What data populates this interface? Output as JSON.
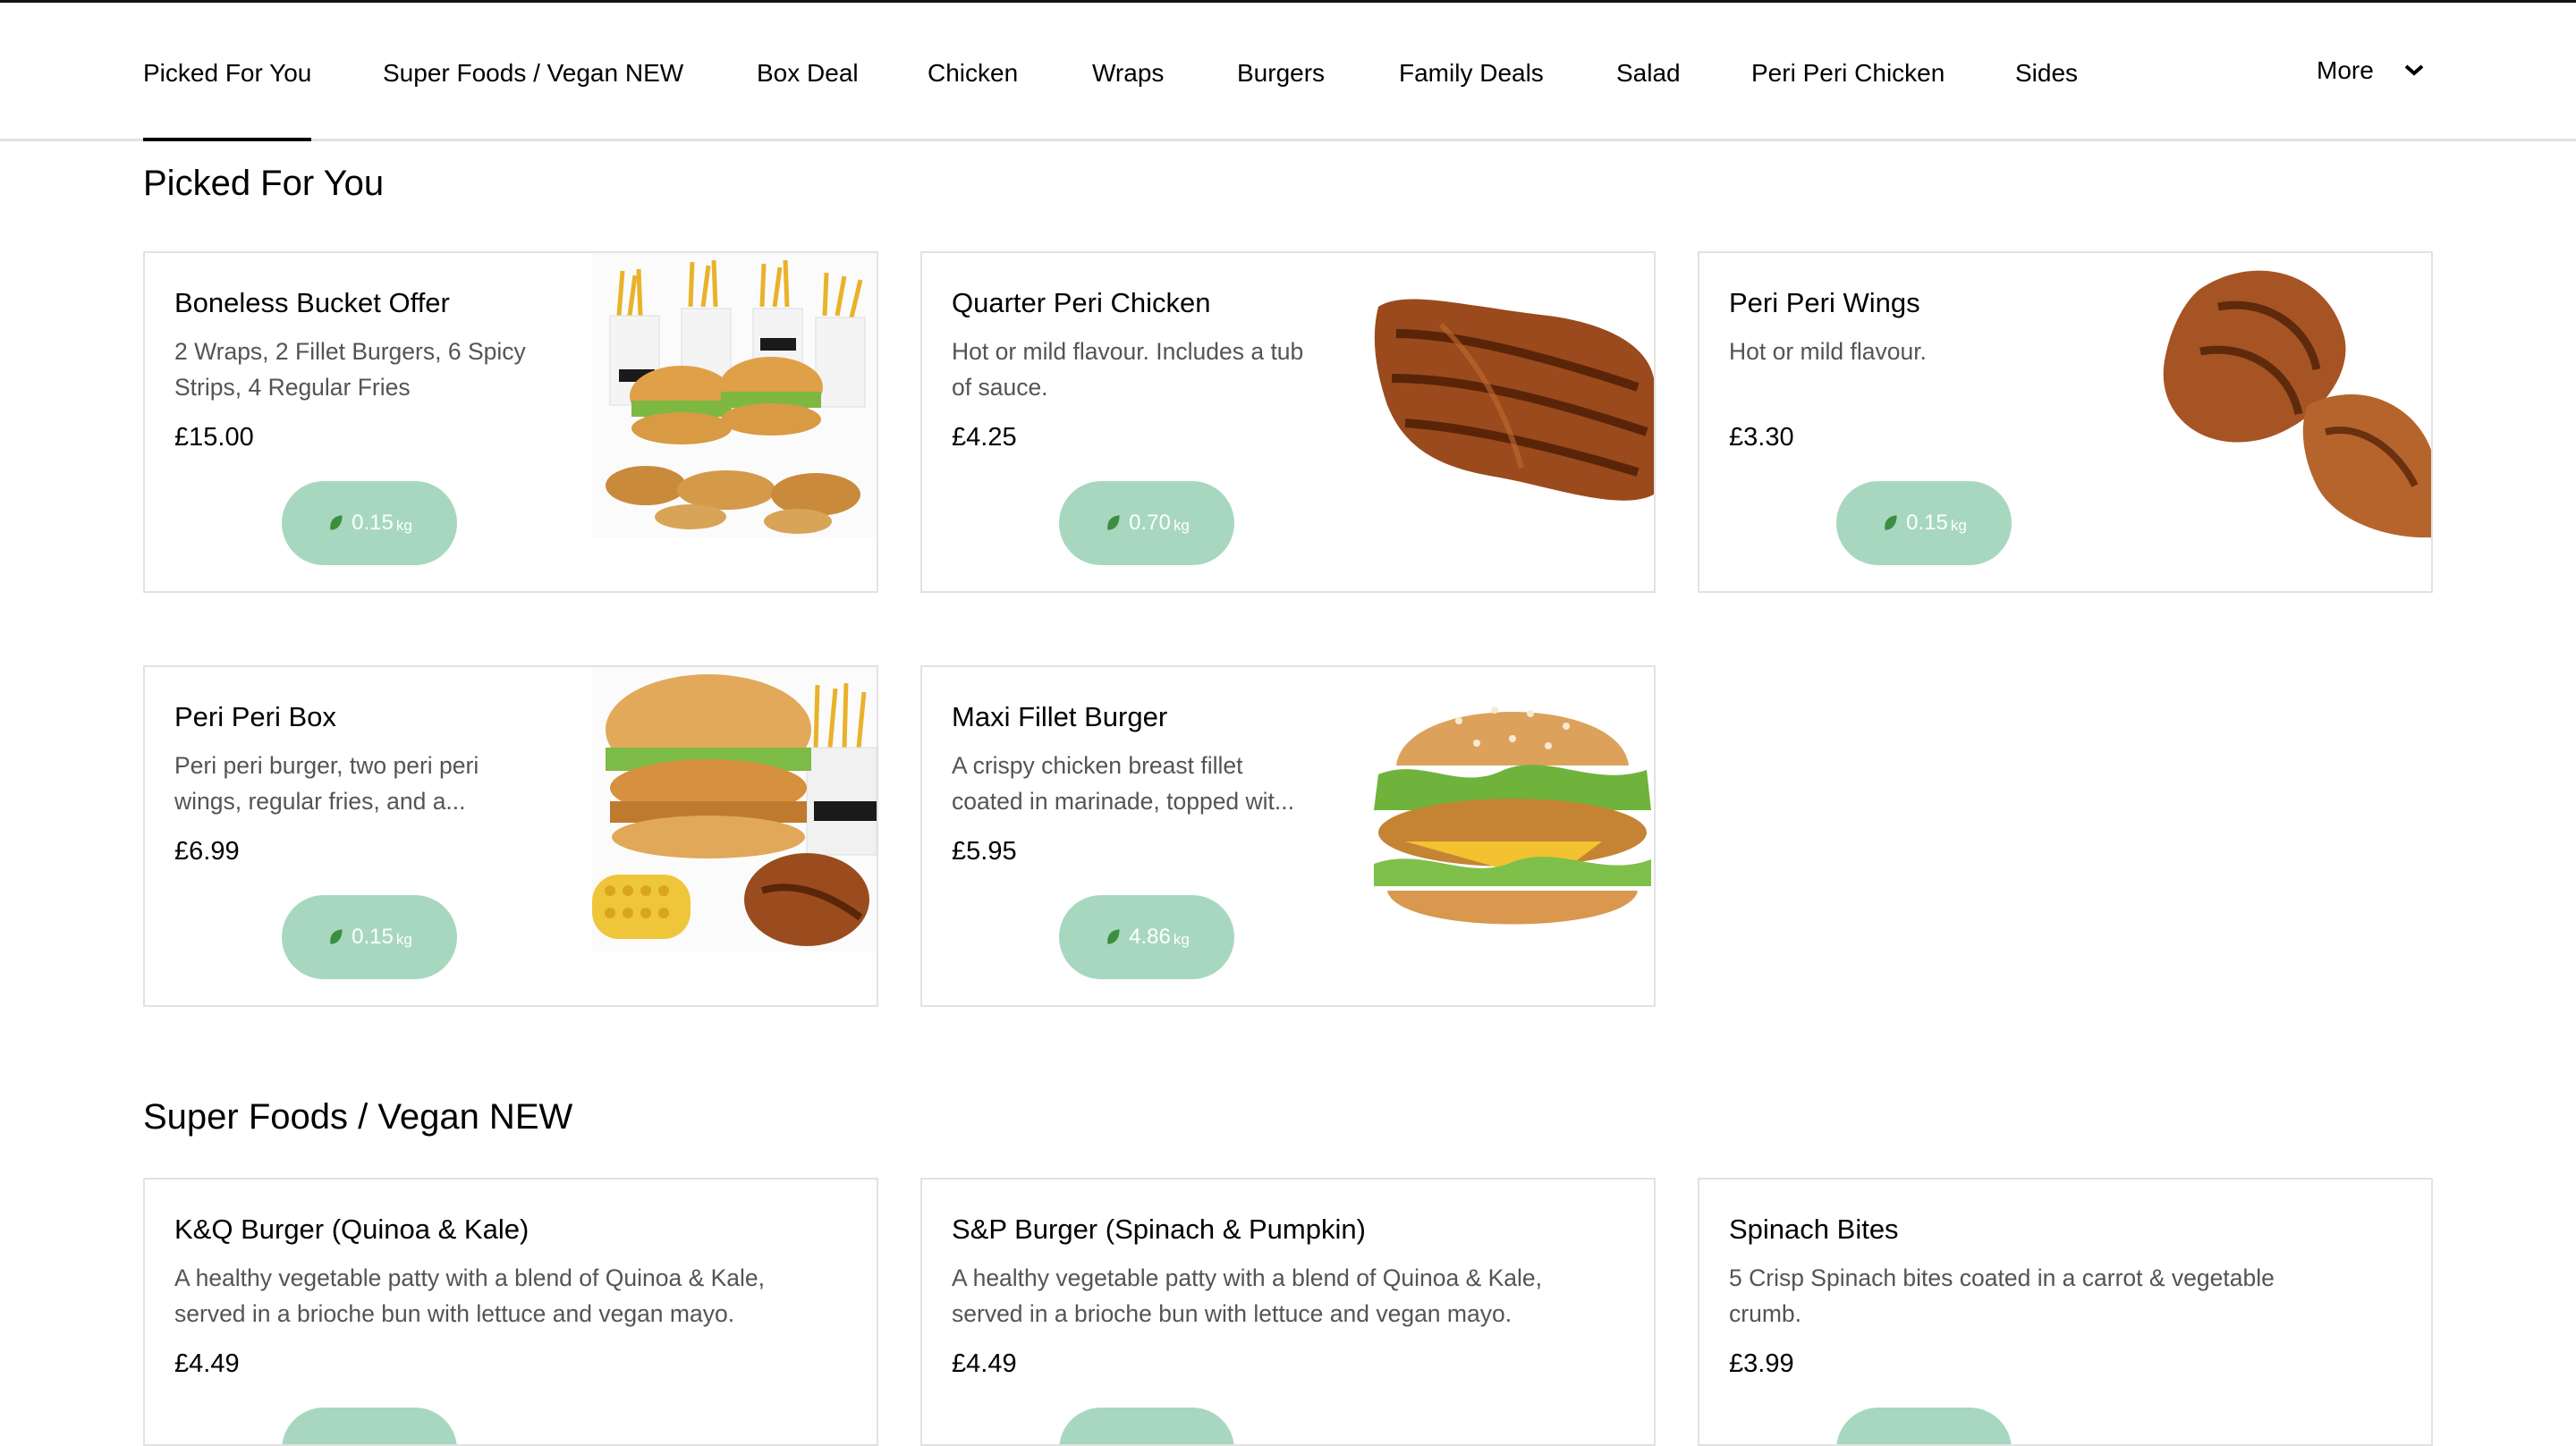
{
  "nav": {
    "tabs": [
      {
        "label": "Picked For You"
      },
      {
        "label": "Super Foods / Vegan NEW"
      },
      {
        "label": "Box Deal"
      },
      {
        "label": "Chicken"
      },
      {
        "label": "Wraps"
      },
      {
        "label": "Burgers"
      },
      {
        "label": "Family Deals"
      },
      {
        "label": "Salad"
      },
      {
        "label": "Peri Peri Chicken"
      },
      {
        "label": "Sides"
      }
    ],
    "more_label": "More"
  },
  "co2_unit": "kg",
  "sections": [
    {
      "title": "Picked For You",
      "items": [
        {
          "name": "Boneless Bucket Offer",
          "desc1": "2 Wraps, 2 Fillet Burgers, 6 Spicy",
          "desc2": "Strips, 4 Regular Fries",
          "price": "£15.00",
          "co2": "0.15",
          "image": "bucket-offer-image"
        },
        {
          "name": "Quarter Peri Chicken",
          "desc1": "Hot or mild flavour. Includes a tub",
          "desc2": "of sauce.",
          "price": "£4.25",
          "co2": "0.70",
          "image": "quarter-chicken-image"
        },
        {
          "name": "Peri Peri Wings",
          "desc1": "Hot or mild flavour.",
          "desc2": "",
          "price": "£3.30",
          "co2": "0.15",
          "image": "wings-image"
        },
        {
          "name": "Peri Peri Box",
          "desc1": "Peri peri burger, two peri peri",
          "desc2": "wings, regular fries, and a...",
          "price": "£6.99",
          "co2": "0.15",
          "image": "peri-box-image"
        },
        {
          "name": "Maxi Fillet Burger",
          "desc1": "A crispy chicken breast fillet",
          "desc2": "coated in marinade, topped wit...",
          "price": "£5.95",
          "co2": "4.86",
          "image": "fillet-burger-image"
        }
      ]
    },
    {
      "title": "Super Foods / Vegan NEW",
      "items": [
        {
          "name": "K&Q Burger (Quinoa & Kale)",
          "desc1": "A healthy vegetable patty with a blend of Quinoa & Kale,",
          "desc2": "served in a brioche bun with lettuce and vegan mayo.",
          "price": "£4.49"
        },
        {
          "name": "S&P Burger (Spinach & Pumpkin)",
          "desc1": "A healthy vegetable patty with a blend of Quinoa & Kale,",
          "desc2": "served in a brioche bun with lettuce and vegan mayo.",
          "price": "£4.49"
        },
        {
          "name": "Spinach Bites",
          "desc1": "5 Crisp Spinach bites coated in a carrot & vegetable",
          "desc2": "crumb.",
          "price": "£3.99"
        }
      ]
    }
  ]
}
